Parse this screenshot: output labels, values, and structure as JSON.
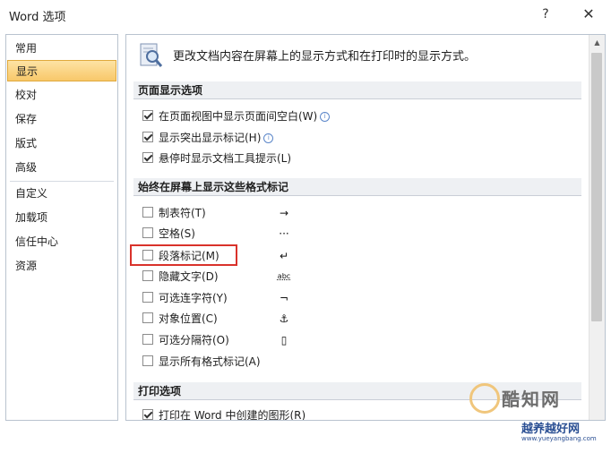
{
  "window": {
    "title": "Word 选项",
    "help_label": "?",
    "close_label": "✕"
  },
  "nav": {
    "items": [
      {
        "label": "常用"
      },
      {
        "label": "显示"
      },
      {
        "label": "校对"
      },
      {
        "label": "保存"
      },
      {
        "label": "版式"
      },
      {
        "label": "高级"
      },
      {
        "label": "自定义"
      },
      {
        "label": "加载项"
      },
      {
        "label": "信任中心"
      },
      {
        "label": "资源"
      }
    ],
    "active": "显示"
  },
  "main": {
    "intro": "更改文档内容在屏幕上的显示方式和在打印时的显示方式。",
    "sections": {
      "page_display": {
        "title": "页面显示选项",
        "options": [
          {
            "label": "在页面视图中显示页面间空白(W)",
            "checked": true
          },
          {
            "label": "显示突出显示标记(H)",
            "checked": true
          },
          {
            "label": "悬停时显示文档工具提示(L)",
            "checked": true
          }
        ]
      },
      "format_marks": {
        "title": "始终在屏幕上显示这些格式标记",
        "options": [
          {
            "label": "制表符(T)",
            "symbol": "→",
            "checked": false
          },
          {
            "label": "空格(S)",
            "symbol": "···",
            "checked": false
          },
          {
            "label": "段落标记(M)",
            "symbol": "↵",
            "checked": false
          },
          {
            "label": "隐藏文字(D)",
            "symbol": "abc",
            "checked": false
          },
          {
            "label": "可选连字符(Y)",
            "symbol": "¬",
            "checked": false
          },
          {
            "label": "对象位置(C)",
            "symbol": "⚓",
            "checked": false
          },
          {
            "label": "可选分隔符(O)",
            "symbol": "▯",
            "checked": false
          },
          {
            "label": "显示所有格式标记(A)",
            "checked": false
          }
        ]
      },
      "print": {
        "title": "打印选项",
        "options": [
          {
            "label": "打印在 Word 中创建的图形(R)",
            "checked": true
          }
        ]
      }
    }
  },
  "watermark": {
    "brand": "酷知网",
    "brand2": "越养越好网",
    "url": "www.yueyangbang.com"
  }
}
